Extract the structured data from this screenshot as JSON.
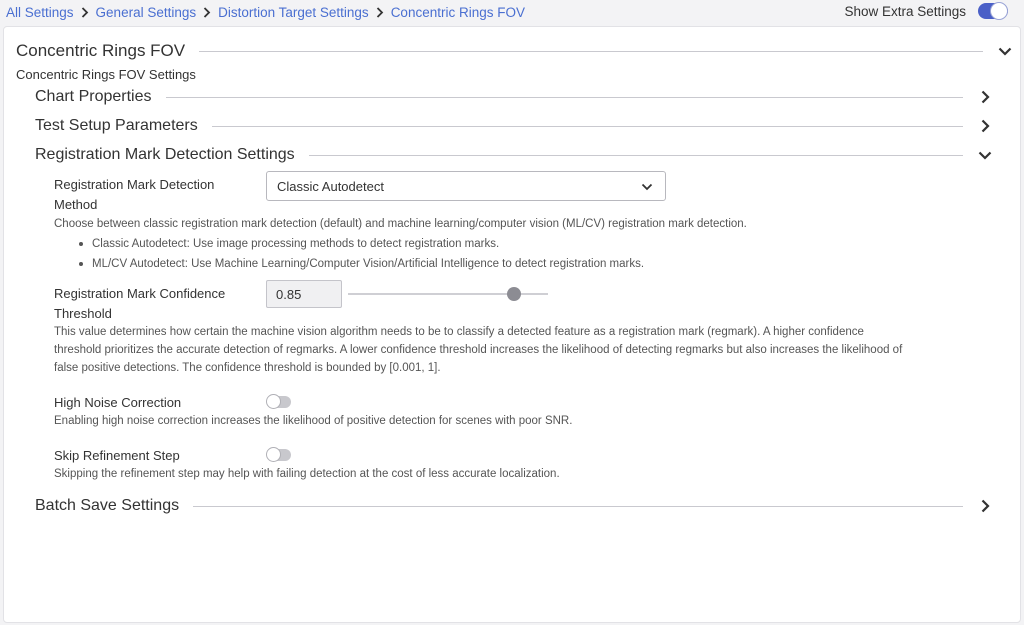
{
  "breadcrumb": [
    "All Settings",
    "General Settings",
    "Distortion Target Settings",
    "Concentric Rings FOV"
  ],
  "show_extra_settings": {
    "label": "Show Extra Settings",
    "enabled": true
  },
  "main": {
    "title": "Concentric Rings FOV",
    "subtitle": "Concentric Rings FOV Settings"
  },
  "sections": {
    "chart_properties": "Chart Properties",
    "test_setup": "Test Setup Parameters",
    "regmark": "Registration Mark Detection Settings",
    "batch_save": "Batch Save Settings"
  },
  "method": {
    "label_line1": "Registration Mark Detection",
    "label_line2": "Method",
    "selected": "Classic Autodetect",
    "description": "Choose between classic registration mark detection (default) and machine learning/computer vision (ML/CV) registration mark detection.",
    "bullets": [
      "Classic Autodetect: Use image processing methods to detect registration marks.",
      "ML/CV Autodetect: Use Machine Learning/Computer Vision/Artificial Intelligence to detect registration marks."
    ]
  },
  "threshold": {
    "label_line1": "Registration Mark Confidence",
    "label_line2": "Threshold",
    "value": "0.85",
    "slider_fraction": 0.83,
    "desc_line1": "This value determines how certain the machine vision algorithm needs to be to classify a detected feature as a registration mark (regmark). A higher confidence",
    "desc_line2": "threshold prioritizes the accurate detection of regmarks. A lower confidence threshold increases the likelihood of detecting regmarks but also increases the likelihood of",
    "desc_line3": "false positive detections. The confidence threshold is bounded by [0.001, 1]."
  },
  "high_noise": {
    "label": "High Noise Correction",
    "enabled": false,
    "description": "Enabling high noise correction increases the likelihood of positive detection for scenes with poor SNR."
  },
  "skip_refinement": {
    "label": "Skip Refinement Step",
    "enabled": false,
    "description": "Skipping the refinement step may help with failing detection at the cost of less accurate localization."
  },
  "colors": {
    "link": "#4a6fd1",
    "toggle_on": "#4a5fc7",
    "toggle_off": "#c8c8cd"
  }
}
